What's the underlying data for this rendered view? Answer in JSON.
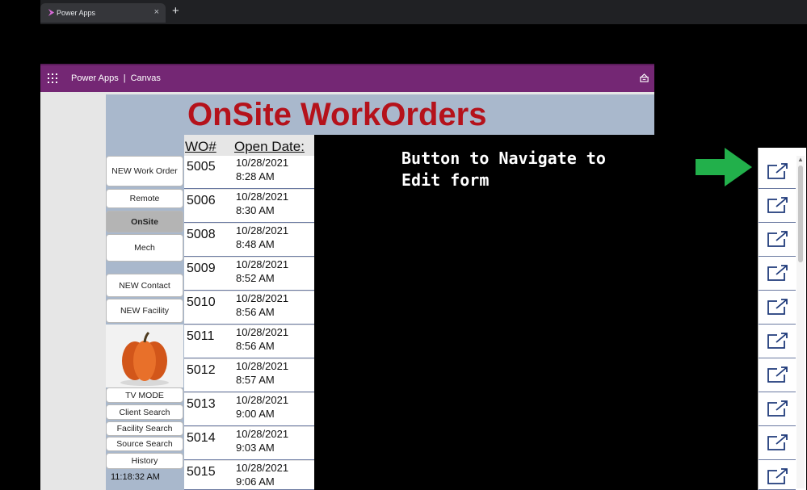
{
  "browser": {
    "tab_title": "Power Apps",
    "close_glyph": "×",
    "newtab_glyph": "+"
  },
  "appbar": {
    "app_name": "Power Apps",
    "separator": "|",
    "mode": "Canvas"
  },
  "page": {
    "title": "OnSite WorkOrders"
  },
  "sidebar": {
    "buttons": [
      {
        "label": "NEW Work Order"
      },
      {
        "label": "Remote"
      },
      {
        "label": "OnSite",
        "selected": true
      },
      {
        "label": "Mech"
      },
      {
        "label": "NEW Contact"
      },
      {
        "label": "NEW Facility"
      },
      {
        "label": "TV MODE"
      },
      {
        "label": "Client Search"
      },
      {
        "label": "Facility Search"
      },
      {
        "label": "Source Search"
      },
      {
        "label": "History"
      }
    ],
    "clock": "11:18:32 AM"
  },
  "table": {
    "headers": {
      "wo": "WO#",
      "open_date": "Open Date:"
    },
    "rows": [
      {
        "wo": "5005",
        "date": "10/28/2021",
        "time": "8:28 AM"
      },
      {
        "wo": "5006",
        "date": "10/28/2021",
        "time": "8:30 AM"
      },
      {
        "wo": "5008",
        "date": "10/28/2021",
        "time": "8:48 AM"
      },
      {
        "wo": "5009",
        "date": "10/28/2021",
        "time": "8:52 AM"
      },
      {
        "wo": "5010",
        "date": "10/28/2021",
        "time": "8:56 AM"
      },
      {
        "wo": "5011",
        "date": "10/28/2021",
        "time": "8:56 AM"
      },
      {
        "wo": "5012",
        "date": "10/28/2021",
        "time": "8:57 AM"
      },
      {
        "wo": "5013",
        "date": "10/28/2021",
        "time": "9:00 AM"
      },
      {
        "wo": "5014",
        "date": "10/28/2021",
        "time": "9:03 AM"
      },
      {
        "wo": "5015",
        "date": "10/28/2021",
        "time": "9:06 AM"
      }
    ]
  },
  "annotation": {
    "line1": "Button to Navigate to",
    "line2": "Edit form"
  },
  "colors": {
    "appbar": "#742774",
    "title": "#b5121b",
    "band": "#a9b8cc",
    "arrow": "#22b04b",
    "icon": "#1f3a7a"
  },
  "icons": {
    "edit": "open-external-icon",
    "arrow": "green-right-arrow-icon"
  }
}
